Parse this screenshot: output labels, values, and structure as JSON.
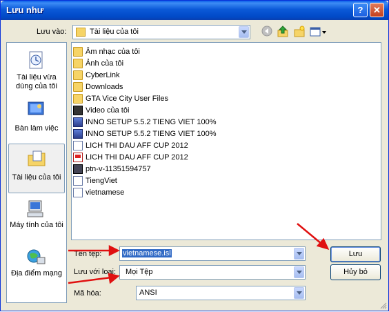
{
  "window": {
    "title": "Lưu như",
    "help_glyph": "?",
    "close_glyph": "✕"
  },
  "toolbar": {
    "save_in_label": "Lưu vào:",
    "save_in_value": "Tài liệu của tôi",
    "icons": [
      "back-icon",
      "up-folder-icon",
      "new-folder-icon",
      "views-icon"
    ]
  },
  "places": [
    {
      "label": "Tài liệu vừa dùng của tôi",
      "icon": "recent-documents-icon"
    },
    {
      "label": "Bàn làm việc",
      "icon": "desktop-icon"
    },
    {
      "label": "Tài liệu của tôi",
      "icon": "my-documents-icon",
      "selected": true
    },
    {
      "label": "Máy tính của tôi",
      "icon": "my-computer-icon"
    },
    {
      "label": "Địa điểm mạng",
      "icon": "network-places-icon"
    }
  ],
  "files": [
    {
      "name": "Âm nhạc của tôi",
      "type": "folder"
    },
    {
      "name": "Ảnh của tôi",
      "type": "folder"
    },
    {
      "name": "CyberLink",
      "type": "folder"
    },
    {
      "name": "Downloads",
      "type": "folder"
    },
    {
      "name": "GTA Vice City User Files",
      "type": "folder"
    },
    {
      "name": "Video của tôi",
      "type": "video"
    },
    {
      "name": "INNO SETUP 5.5.2 TIENG VIET 100%",
      "type": "setup"
    },
    {
      "name": "INNO SETUP 5.5.2 TIENG VIET 100%",
      "type": "setup"
    },
    {
      "name": "LICH THI DAU AFF CUP 2012",
      "type": "doc"
    },
    {
      "name": "LICH THI DAU AFF CUP 2012",
      "type": "pdf"
    },
    {
      "name": "ptn-v-11351594757",
      "type": "rm"
    },
    {
      "name": "TiengViet",
      "type": "doc"
    },
    {
      "name": "vietnamese",
      "type": "doc"
    }
  ],
  "form": {
    "filename_label": "Tên tệp:",
    "filename_value": "vietnamese.isl",
    "filetype_label": "Lưu với loại:",
    "filetype_value": "Mọi Tệp",
    "encoding_label": "Mã hóa:",
    "encoding_value": "ANSI"
  },
  "buttons": {
    "save": "Lưu",
    "cancel": "Hủy bỏ"
  },
  "colors": {
    "titlebar": "#0058e6",
    "selection": "#316ac5",
    "annotation_arrow": "#e01010"
  }
}
